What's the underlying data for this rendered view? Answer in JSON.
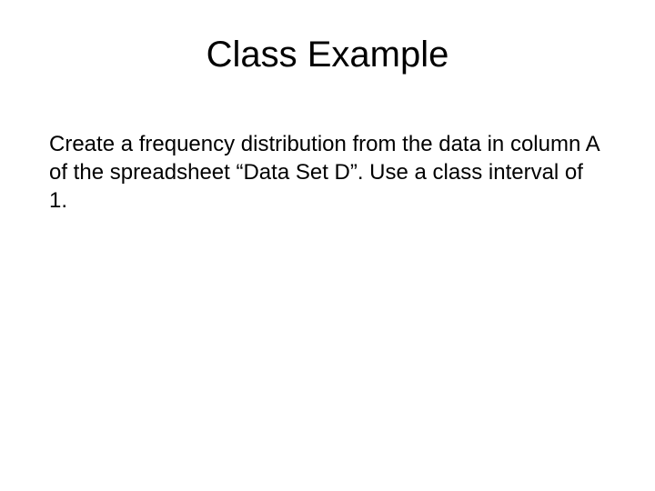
{
  "slide": {
    "title": "Class Example",
    "body": "Create a frequency distribution from the data in column A of the spreadsheet “Data Set D”.  Use a class interval of 1."
  }
}
